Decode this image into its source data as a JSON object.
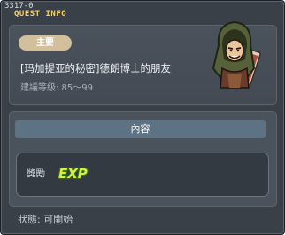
{
  "window": {
    "quest_id": "3317-0",
    "title": "QUEST INFO"
  },
  "header": {
    "category": "主要",
    "quest_name": "[玛加提亚的秘密]德朗博士的朋友",
    "level_req": "建議等級: 85～99",
    "npc_icon": "hooded-npc-portrait"
  },
  "content": {
    "tab_label": "內容",
    "reward_label": "獎勵",
    "reward_badge": "EXP",
    "reward_icon": "exp-icon"
  },
  "status": {
    "text": "狀態: 可開始"
  },
  "colors": {
    "window_bg": "#3a4048",
    "title_yellow": "#f4d060",
    "badge_tan": "#d2bf9c",
    "tab_blue": "#5d7283",
    "exp_green": "#d8f03a"
  }
}
